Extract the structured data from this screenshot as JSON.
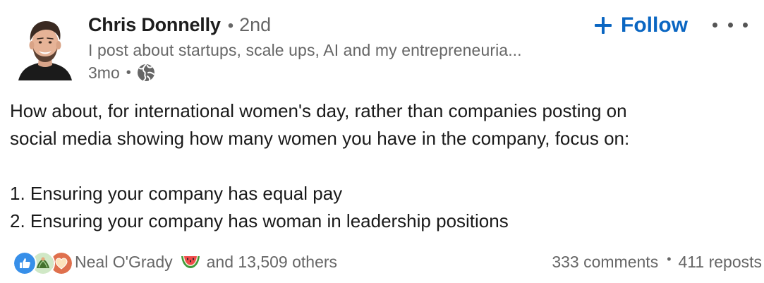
{
  "author": {
    "name": "Chris Donnelly",
    "degree": "2nd",
    "separator": "•",
    "headline": "I post about startups, scale ups, AI and my entrepreneuria...",
    "time_ago": "3mo",
    "visibility_icon": "globe-icon"
  },
  "actions": {
    "follow_label": "Follow",
    "follow_icon": "plus-icon",
    "more_icon": "ellipsis-icon"
  },
  "post": {
    "lines": [
      "How about, for international women's day, rather than companies posting on",
      "social media showing how many women you have in the company, focus on:",
      "",
      "1. Ensuring your company has equal pay",
      "2. Ensuring your company has woman in leadership positions"
    ]
  },
  "social": {
    "reaction_icons": [
      "like-icon",
      "support-icon",
      "love-icon"
    ],
    "reactor_name": "Neal O'Grady",
    "reactor_emoji": "watermelon-icon",
    "others_text": "and 13,509 others",
    "comments_text": "333 comments",
    "separator": "•",
    "reposts_text": "411 reposts"
  },
  "colors": {
    "link_blue": "#0a66c2",
    "muted_text": "#666666",
    "like_blue": "#378fe9",
    "support_green": "#44712e",
    "love_orange": "#df704d"
  }
}
